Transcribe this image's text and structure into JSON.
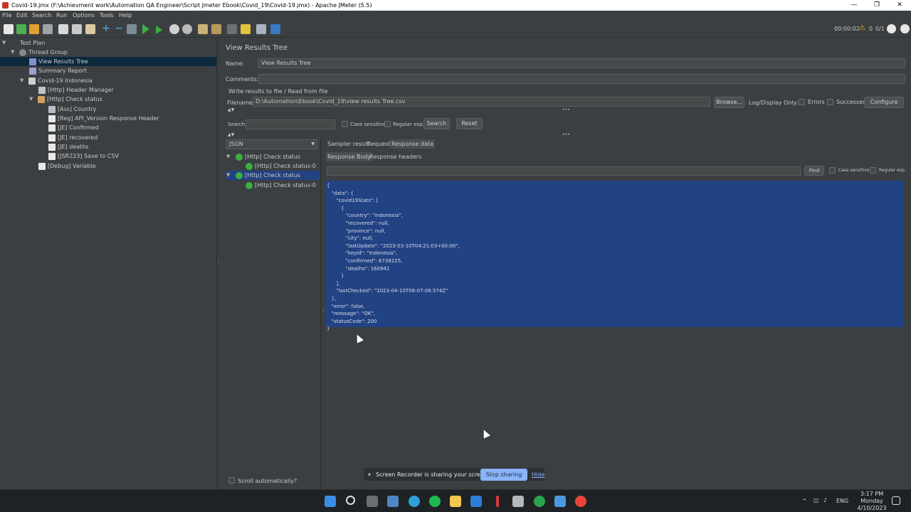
{
  "window": {
    "title": "Covid-19.jmx (F:\\Achievment work\\Automation QA Engineer\\Script Jmeter Ebook\\Covid_19\\Covid-19.jmx) - Apache JMeter (5.5)",
    "minimize": "—",
    "restore": "❐",
    "close": "✕"
  },
  "menu": [
    "File",
    "Edit",
    "Search",
    "Run",
    "Options",
    "Tools",
    "Help"
  ],
  "toolbar": {
    "elapsed": "00:00:02",
    "warnings": "0",
    "threads": "0/1"
  },
  "tree": {
    "items": [
      {
        "label": "Test Plan"
      },
      {
        "label": "Thread Group"
      },
      {
        "label": "View Results Tree"
      },
      {
        "label": "Summary Report"
      },
      {
        "label": "Covid-19 Indonesia"
      },
      {
        "label": "[Http] Header Manager"
      },
      {
        "label": "[Http] Check status"
      },
      {
        "label": "[Ass] Country"
      },
      {
        "label": "[Reg] API_Version Response Header"
      },
      {
        "label": "[JE] Confirmed"
      },
      {
        "label": "[JE] recovered"
      },
      {
        "label": "[JE] deaths"
      },
      {
        "label": "[JSR223] Save to CSV"
      },
      {
        "label": "[Debug] Variable"
      }
    ]
  },
  "panel": {
    "title": "View Results Tree",
    "name_label": "Name:",
    "name_value": "View Results Tree",
    "comments_label": "Comments:",
    "comments_value": "",
    "write_results": "Write results to file / Read from file",
    "filename_label": "Filename",
    "filename_value": "D:\\Automation\\Ebook\\Covid_19\\view results Tree.csv",
    "browse": "Browse...",
    "log_display": "Log/Display Only:",
    "errors": "Errors",
    "successes": "Successes",
    "configure": "Configure",
    "search_label": "Search:",
    "search_value": "",
    "case_sensitive": "Case sensitive",
    "regular_exp": "Regular exp.",
    "search_btn": "Search",
    "reset_btn": "Reset",
    "renderer": "JSON",
    "scroll_auto": "Scroll automatically?"
  },
  "results": [
    {
      "label": "[Http] Check status"
    },
    {
      "label": "[Http] Check status-0"
    },
    {
      "label": "[Http] Check status"
    },
    {
      "label": "[Http] Check status-0"
    }
  ],
  "tabs": {
    "sampler": "Sampler result",
    "request": "Request",
    "response": "Response data",
    "body": "Response Body",
    "headers": "Response headers",
    "find": "Find",
    "case_sensitive": "Case sensitive",
    "regular_exp": "Regular exp."
  },
  "response_lines": [
    "{",
    "   \"data\": {",
    "      \"covid19Stats\": [",
    "         {",
    "            \"country\": \"Indonesia\",",
    "            \"recovered\": null,",
    "            \"province\": null,",
    "            \"city\": null,",
    "            \"lastUpdate\": \"2023-03-10T04:21:03+00:00\",",
    "            \"keyId\": \"Indonesia\",",
    "            \"confirmed\": 6738225,",
    "            \"deaths\": 160941",
    "         }",
    "      ],",
    "      \"lastChecked\": \"2023-04-10T08:07:08.574Z\"",
    "   },",
    "   \"error\": false,",
    "   \"message\": \"OK\",",
    "   \"statusCode\": 200",
    "}"
  ],
  "share": {
    "text": "Screen Recorder is sharing your screen.",
    "stop": "Stop sharing",
    "hide": "Hide"
  },
  "taskbar": {
    "lang": "ENG",
    "time": "3:17 PM",
    "day": "Monday",
    "date": "4/10/2023"
  }
}
